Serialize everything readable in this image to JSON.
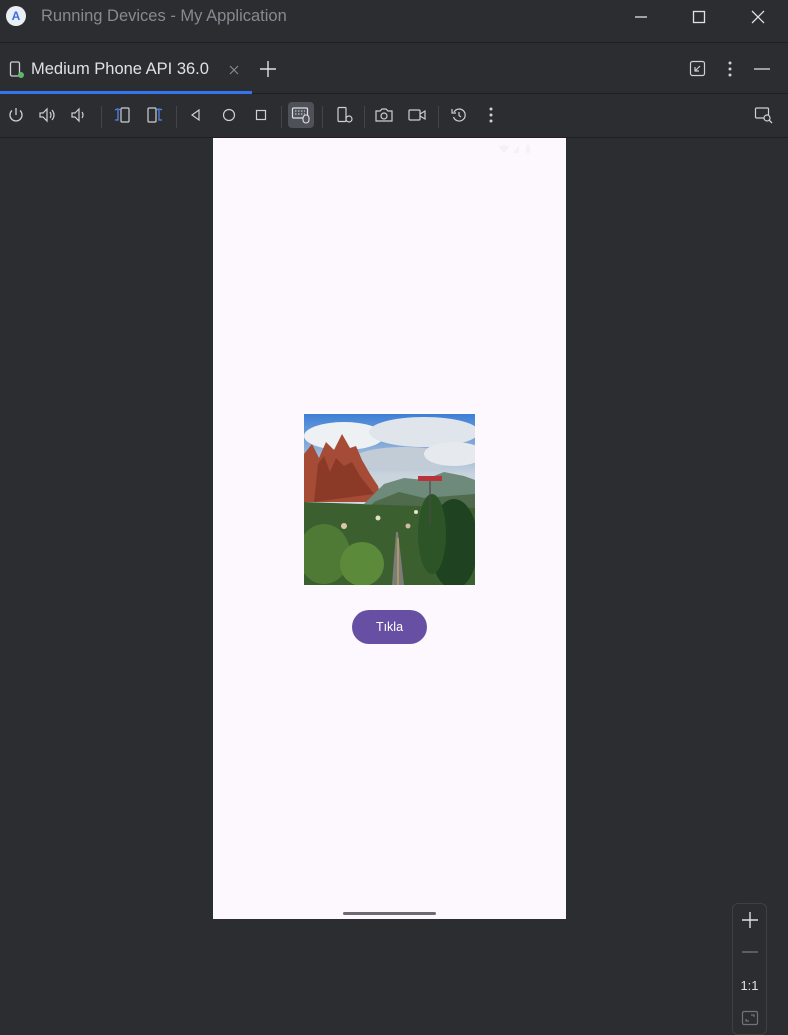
{
  "window": {
    "title": "Running Devices - My Application"
  },
  "tabs": [
    {
      "label": "Medium Phone API 36.0",
      "icon": "device-icon",
      "active": true
    }
  ],
  "toolbar": {
    "icons": [
      "power-icon",
      "volume-up-icon",
      "volume-down-icon",
      "rotate-left-icon",
      "rotate-right-icon",
      "back-icon",
      "home-icon",
      "overview-icon",
      "keyboard-mouse-icon",
      "device-settings-icon",
      "screenshot-icon",
      "screen-record-icon",
      "reset-icon",
      "more-icon",
      "device-explorer-icon"
    ],
    "active": "keyboard-mouse-icon"
  },
  "device_screen": {
    "background": "#fdf7fe",
    "button_label": "Tıkla",
    "button_color": "#6750a4"
  },
  "zoom": {
    "actual_size_label": "1:1"
  },
  "colors": {
    "accent": "#3574f0",
    "background": "#2b2d30"
  }
}
